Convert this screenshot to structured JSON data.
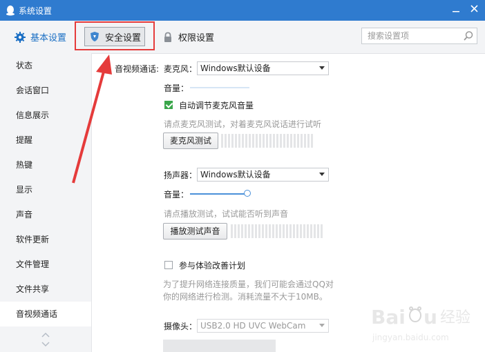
{
  "window": {
    "title": "系统设置"
  },
  "toolbar": {
    "basic_label": "基本设置",
    "security_label": "安全设置",
    "permission_label": "权限设置"
  },
  "search": {
    "placeholder": "搜索设置项",
    "icon": "search-icon"
  },
  "sidebar": {
    "items": [
      {
        "label": "状态"
      },
      {
        "label": "会话窗口"
      },
      {
        "label": "信息展示"
      },
      {
        "label": "提醒"
      },
      {
        "label": "热键"
      },
      {
        "label": "显示"
      },
      {
        "label": "声音"
      },
      {
        "label": "软件更新"
      },
      {
        "label": "文件管理"
      },
      {
        "label": "文件共享"
      },
      {
        "label": "音视频通话"
      }
    ],
    "active_item": "音视频通话"
  },
  "av": {
    "section_label": "音视频通话:",
    "mic": {
      "label": "麦克风：",
      "device": "Windows默认设备",
      "volume_label": "音量：",
      "auto_adjust_label": "自动调节麦克风音量",
      "auto_adjust_checked": true,
      "hint": "请点麦克风测试，对着麦克风说话进行试听",
      "test_button": "麦克风测试",
      "volume_level": 0.0
    },
    "speaker": {
      "label": "扬声器：",
      "device": "Windows默认设备",
      "volume_label": "音量：",
      "hint": "请点播放测试，试试能否听到声音",
      "test_button": "播放测试声音",
      "volume_level": 1.0
    },
    "improve": {
      "label": "参与体验改善计划",
      "checked": false,
      "desc_line1": "为了提升网络连接质量，我们可能会通过QQ对",
      "desc_line2": "你的网络进行检测。消耗流量不大于10MB。"
    },
    "camera": {
      "label": "摄像头：",
      "device": "USB2.0 HD UVC WebCam"
    }
  },
  "watermark": {
    "brand": "Baidu经验",
    "url": "jingyan.baidu.com"
  },
  "colors": {
    "titlebar": "#2f7bcf",
    "accent": "#1b6fc4",
    "highlight": "#e53b3b",
    "check": "#3aa64b"
  }
}
